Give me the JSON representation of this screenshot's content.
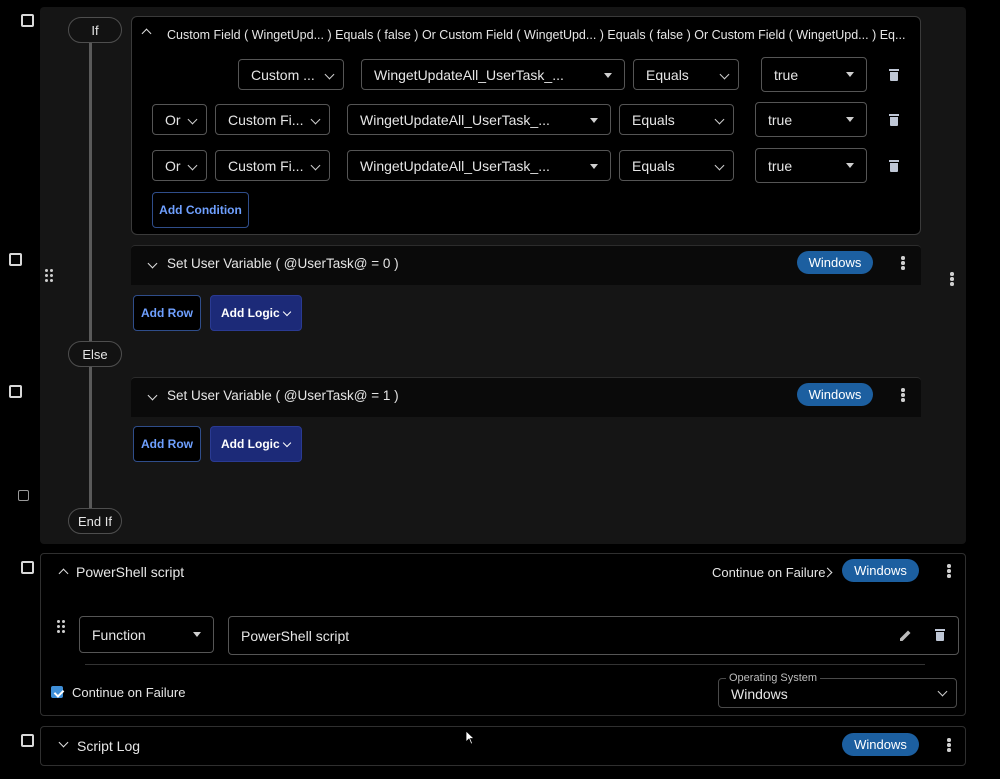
{
  "if_block": {
    "if_label": "If",
    "else_label": "Else",
    "end_if_label": "End If",
    "condition_summary": "Custom Field ( WingetUpd... ) Equals ( false ) Or Custom Field ( WingetUpd... ) Equals ( false ) Or Custom Field ( WingetUpd... ) Eq...",
    "conditions": [
      {
        "logic": "",
        "type": "Custom ...",
        "field": "WingetUpdateAll_UserTask_...",
        "operator": "Equals",
        "value": "true"
      },
      {
        "logic": "Or",
        "type": "Custom Fi...",
        "field": "WingetUpdateAll_UserTask_...",
        "operator": "Equals",
        "value": "true"
      },
      {
        "logic": "Or",
        "type": "Custom Fi...",
        "field": "WingetUpdateAll_UserTask_...",
        "operator": "Equals",
        "value": "true"
      }
    ],
    "add_condition_label": "Add Condition",
    "then_row": {
      "label": "Set User Variable ( @UserTask@ = 0 )",
      "os": "Windows"
    },
    "else_row": {
      "label": "Set User Variable ( @UserTask@ = 1 )",
      "os": "Windows"
    },
    "add_row_label": "Add Row",
    "add_logic_label": "Add Logic"
  },
  "powershell": {
    "title": "PowerShell script",
    "continue_on_failure_link": "Continue on Failure",
    "os": "Windows",
    "function_select": "Function",
    "script_name": "PowerShell script",
    "continue_checkbox_label": "Continue on Failure",
    "continue_checked": true,
    "os_field_label": "Operating System",
    "os_field_value": "Windows"
  },
  "script_log": {
    "title": "Script Log",
    "os": "Windows"
  },
  "colors": {
    "badge": "#1c5fa0",
    "primary_button": "#1c2a78",
    "outline_text": "#6fa0ff"
  }
}
